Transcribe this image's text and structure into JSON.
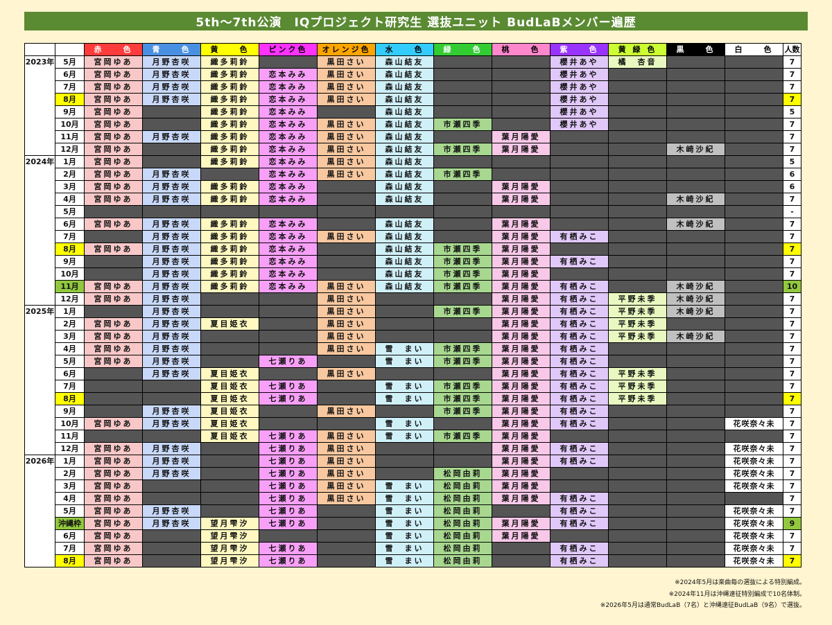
{
  "title": "5th〜7th公演　IQプロジェクト研究生 選抜ユニット BudLaBメンバー遍歴",
  "header": {
    "year": "",
    "month": "",
    "count": "人数",
    "colors": [
      {
        "label": "赤　　色",
        "bg": "#ff3b3b",
        "fg": "#ffffff"
      },
      {
        "label": "青　　色",
        "bg": "#4a90e2",
        "fg": "#ffffff"
      },
      {
        "label": "黄　　色",
        "bg": "#ffff00",
        "fg": "#000000"
      },
      {
        "label": "ピンク色",
        "bg": "#ff33ff",
        "fg": "#000000"
      },
      {
        "label": "オレンジ色",
        "bg": "#ffa500",
        "fg": "#000000"
      },
      {
        "label": "水　　色",
        "bg": "#33ccff",
        "fg": "#000000"
      },
      {
        "label": "緑　　色",
        "bg": "#33cc33",
        "fg": "#ffffff"
      },
      {
        "label": "桃　　色",
        "bg": "#ff88cc",
        "fg": "#000000"
      },
      {
        "label": "紫　　色",
        "bg": "#9933ff",
        "fg": "#ffffff"
      },
      {
        "label": "黄 緑 色",
        "bg": "#ccff33",
        "fg": "#000000"
      },
      {
        "label": "黒　　色",
        "bg": "#000000",
        "fg": "#ffffff"
      },
      {
        "label": "白　　色",
        "bg": "#ffffff",
        "fg": "#000000"
      }
    ]
  },
  "cell_colors": [
    "#f8c8c8",
    "#c8d8f8",
    "#fff8c0",
    "#f8a0f8",
    "#f8c8a0",
    "#d0f0f8",
    "#a8d890",
    "#f8c8e8",
    "#e0c8f8",
    "#e8f8c0",
    "#c0c0c0",
    "#ffffff"
  ],
  "members": {
    "r": "宮岡ゆあ",
    "b": "月野杏咲",
    "y1": "織多莉鈴",
    "y2": "夏目姫衣",
    "y3": "望月雫汐",
    "p1": "恋本みみ",
    "p2": "七瀬りあ",
    "o": "黒田さい",
    "w1": "森山結友",
    "w2": "雪　まい",
    "g1": "市瀬四季",
    "g2": "松岡由莉",
    "m": "葉月陽愛",
    "v1": "櫻井あや",
    "v2": "有栖みこ",
    "l1": "橘　杏音",
    "l2": "平野未季",
    "k": "木崎沙紀",
    "wh": "花咲奈々未"
  },
  "rows": [
    {
      "year": "2023年",
      "month": "5月",
      "count": "7",
      "cells": [
        "r",
        "b",
        "y1",
        "",
        "o",
        "w1",
        "",
        "",
        "v1",
        "l1",
        "",
        ""
      ]
    },
    {
      "year": "",
      "month": "6月",
      "count": "7",
      "cells": [
        "r",
        "b",
        "y1",
        "p1",
        "o",
        "w1",
        "",
        "",
        "v1",
        "",
        "",
        ""
      ]
    },
    {
      "year": "",
      "month": "7月",
      "count": "7",
      "cells": [
        "r",
        "b",
        "y1",
        "p1",
        "o",
        "w1",
        "",
        "",
        "v1",
        "",
        "",
        ""
      ]
    },
    {
      "year": "",
      "month": "8月",
      "count": "7",
      "hl": "yellow",
      "cells": [
        "r",
        "b",
        "y1",
        "p1",
        "o",
        "w1",
        "",
        "",
        "v1",
        "",
        "",
        ""
      ]
    },
    {
      "year": "",
      "month": "9月",
      "count": "5",
      "cells": [
        "r",
        "",
        "y1",
        "p1",
        "",
        "w1",
        "",
        "",
        "v1",
        "",
        "",
        ""
      ]
    },
    {
      "year": "",
      "month": "10月",
      "count": "7",
      "cells": [
        "r",
        "",
        "y1",
        "p1",
        "o",
        "w1",
        "g1",
        "",
        "v1",
        "",
        "",
        ""
      ]
    },
    {
      "year": "",
      "month": "11月",
      "count": "7",
      "cells": [
        "r",
        "b",
        "y1",
        "p1",
        "o",
        "w1",
        "",
        "m",
        "",
        "",
        "",
        ""
      ]
    },
    {
      "year": "",
      "month": "12月",
      "count": "7",
      "cells": [
        "r",
        "",
        "y1",
        "p1",
        "o",
        "w1",
        "g1",
        "m",
        "",
        "",
        "k",
        ""
      ]
    },
    {
      "year": "2024年",
      "month": "1月",
      "count": "5",
      "cells": [
        "r",
        "",
        "y1",
        "p1",
        "o",
        "w1",
        "",
        "",
        "",
        "",
        "",
        ""
      ]
    },
    {
      "year": "",
      "month": "2月",
      "count": "6",
      "cells": [
        "r",
        "b",
        "",
        "p1",
        "o",
        "w1",
        "g1",
        "",
        "",
        "",
        "",
        ""
      ]
    },
    {
      "year": "",
      "month": "3月",
      "count": "6",
      "cells": [
        "r",
        "b",
        "y1",
        "p1",
        "",
        "w1",
        "",
        "m",
        "",
        "",
        "",
        ""
      ]
    },
    {
      "year": "",
      "month": "4月",
      "count": "7",
      "cells": [
        "r",
        "b",
        "y1",
        "p1",
        "",
        "w1",
        "",
        "m",
        "",
        "",
        "k",
        ""
      ]
    },
    {
      "year": "",
      "month": "5月",
      "count": "-",
      "cells": [
        "",
        "",
        "",
        "",
        "",
        "",
        "",
        "",
        "",
        "",
        "",
        ""
      ]
    },
    {
      "year": "",
      "month": "6月",
      "count": "7",
      "cells": [
        "r",
        "b",
        "y1",
        "p1",
        "",
        "w1",
        "",
        "m",
        "",
        "",
        "k",
        ""
      ]
    },
    {
      "year": "",
      "month": "7月",
      "count": "7",
      "cells": [
        "",
        "b",
        "y1",
        "p1",
        "o",
        "w1",
        "",
        "m",
        "v2",
        "",
        "",
        ""
      ]
    },
    {
      "year": "",
      "month": "8月",
      "count": "7",
      "hl": "yellow",
      "cells": [
        "r",
        "b",
        "y1",
        "p1",
        "",
        "w1",
        "g1",
        "m",
        "",
        "",
        "",
        ""
      ]
    },
    {
      "year": "",
      "month": "9月",
      "count": "7",
      "cells": [
        "",
        "b",
        "y1",
        "p1",
        "",
        "w1",
        "g1",
        "m",
        "v2",
        "",
        "",
        ""
      ]
    },
    {
      "year": "",
      "month": "10月",
      "count": "7",
      "cells": [
        "",
        "b",
        "y1",
        "p1",
        "",
        "w1",
        "g1",
        "m",
        "",
        "",
        "",
        ""
      ]
    },
    {
      "year": "",
      "month": "11月",
      "count": "10",
      "hl": "green",
      "cells": [
        "r",
        "b",
        "y1",
        "p1",
        "o",
        "w1",
        "g1",
        "m",
        "v2",
        "",
        "k",
        ""
      ]
    },
    {
      "year": "",
      "month": "12月",
      "count": "7",
      "cells": [
        "r",
        "b",
        "",
        "",
        "o",
        "",
        "",
        "m",
        "v2",
        "l2",
        "k",
        ""
      ]
    },
    {
      "year": "2025年",
      "month": "1月",
      "count": "7",
      "cells": [
        "",
        "b",
        "",
        "",
        "o",
        "",
        "g1",
        "m",
        "v2",
        "l2",
        "k",
        ""
      ]
    },
    {
      "year": "",
      "month": "2月",
      "count": "7",
      "cells": [
        "r",
        "b",
        "y2",
        "",
        "o",
        "",
        "",
        "m",
        "v2",
        "l2",
        "",
        ""
      ]
    },
    {
      "year": "",
      "month": "3月",
      "count": "7",
      "cells": [
        "r",
        "b",
        "",
        "",
        "o",
        "",
        "",
        "m",
        "v2",
        "l2",
        "k",
        ""
      ]
    },
    {
      "year": "",
      "month": "4月",
      "count": "7",
      "cells": [
        "r",
        "b",
        "",
        "",
        "o",
        "w2",
        "g1",
        "m",
        "v2",
        "",
        "",
        ""
      ]
    },
    {
      "year": "",
      "month": "5月",
      "count": "7",
      "cells": [
        "r",
        "b",
        "",
        "p2",
        "",
        "w2",
        "g1",
        "m",
        "v2",
        "",
        "",
        ""
      ]
    },
    {
      "year": "",
      "month": "6月",
      "count": "7",
      "cells": [
        "",
        "b",
        "y2",
        "",
        "o",
        "",
        "",
        "m",
        "v2",
        "l2",
        "",
        ""
      ]
    },
    {
      "year": "",
      "month": "7月",
      "count": "7",
      "cells": [
        "",
        "",
        "y2",
        "p2",
        "",
        "w2",
        "g1",
        "m",
        "v2",
        "l2",
        "",
        ""
      ]
    },
    {
      "year": "",
      "month": "8月",
      "count": "7",
      "hl": "yellow",
      "cells": [
        "",
        "",
        "y2",
        "p2",
        "",
        "w2",
        "g1",
        "m",
        "v2",
        "l2",
        "",
        ""
      ]
    },
    {
      "year": "",
      "month": "9月",
      "count": "7",
      "cells": [
        "",
        "b",
        "y2",
        "",
        "o",
        "",
        "g1",
        "m",
        "v2",
        "",
        "",
        ""
      ]
    },
    {
      "year": "",
      "month": "10月",
      "count": "7",
      "cells": [
        "r",
        "b",
        "y2",
        "",
        "",
        "w2",
        "",
        "m",
        "v2",
        "",
        "",
        "wh"
      ]
    },
    {
      "year": "",
      "month": "11月",
      "count": "7",
      "cells": [
        "",
        "",
        "y2",
        "p2",
        "o",
        "w2",
        "g1",
        "m",
        "",
        "",
        "",
        ""
      ]
    },
    {
      "year": "",
      "month": "12月",
      "count": "7",
      "cells": [
        "r",
        "b",
        "",
        "p2",
        "o",
        "",
        "",
        "m",
        "v2",
        "",
        "",
        "wh"
      ]
    },
    {
      "year": "2026年",
      "month": "1月",
      "count": "7",
      "cells": [
        "r",
        "b",
        "",
        "p2",
        "o",
        "",
        "",
        "m",
        "v2",
        "",
        "",
        "wh"
      ]
    },
    {
      "year": "",
      "month": "2月",
      "count": "7",
      "cells": [
        "r",
        "b",
        "",
        "p2",
        "o",
        "",
        "g2",
        "m",
        "",
        "",
        "",
        "wh"
      ]
    },
    {
      "year": "",
      "month": "3月",
      "count": "7",
      "cells": [
        "r",
        "",
        "",
        "p2",
        "o",
        "w2",
        "g2",
        "m",
        "",
        "",
        "",
        "wh"
      ]
    },
    {
      "year": "",
      "month": "4月",
      "count": "7",
      "cells": [
        "r",
        "",
        "",
        "p2",
        "o",
        "w2",
        "g2",
        "m",
        "v2",
        "",
        "",
        ""
      ]
    },
    {
      "year": "",
      "month": "5月",
      "count": "7",
      "cells": [
        "r",
        "b",
        "",
        "p2",
        "",
        "w2",
        "g2",
        "",
        "v2",
        "",
        "",
        "wh"
      ]
    },
    {
      "year": "",
      "month": "沖縄枠",
      "count": "9",
      "hl": "green",
      "cells": [
        "r",
        "b",
        "y3",
        "p2",
        "",
        "w2",
        "g2",
        "m",
        "v2",
        "",
        "",
        "wh"
      ]
    },
    {
      "year": "",
      "month": "6月",
      "count": "7",
      "cells": [
        "r",
        "",
        "y3",
        "",
        "",
        "w2",
        "g2",
        "m",
        "",
        "",
        "",
        "wh"
      ]
    },
    {
      "year": "",
      "month": "7月",
      "count": "7",
      "cells": [
        "r",
        "",
        "y3",
        "p2",
        "",
        "w2",
        "g2",
        "",
        "v2",
        "",
        "",
        "wh"
      ]
    },
    {
      "year": "",
      "month": "8月",
      "count": "7",
      "hl": "yellow",
      "cells": [
        "r",
        "",
        "y3",
        "p2",
        "",
        "w2",
        "g2",
        "",
        "v2",
        "",
        "",
        "wh"
      ]
    }
  ],
  "notes": [
    "※2024年5月は楽曲毎の選抜による特別編成。",
    "※2024年11月は沖縄遠征特別編成で10名体制。",
    "※2026年5月は通常BudLaB（7名）と沖縄遠征BudLaB（9名）で選抜。"
  ]
}
